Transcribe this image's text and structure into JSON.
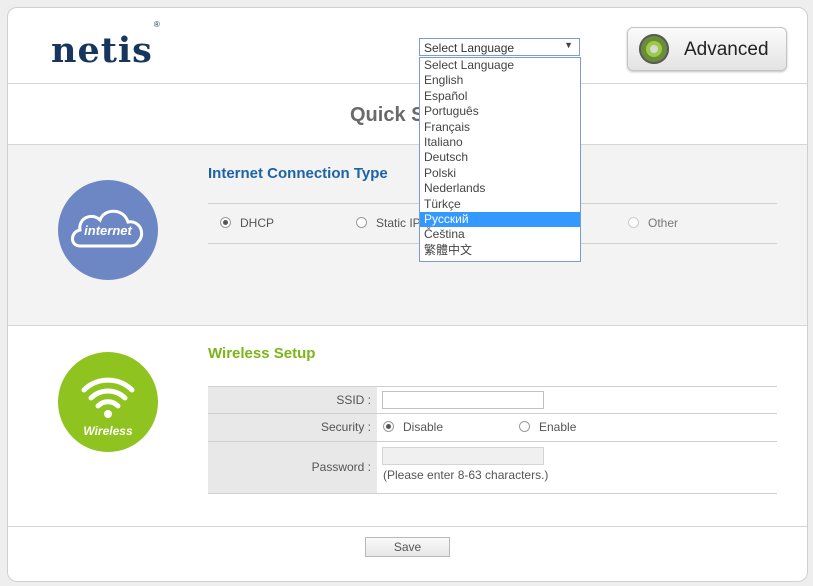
{
  "header": {
    "logo": "netis",
    "logo_mark": "®",
    "language_select": {
      "current": "Select Language",
      "options": [
        "Select Language",
        "English",
        "Español",
        "Português",
        "Français",
        "Italiano",
        "Deutsch",
        "Polski",
        "Nederlands",
        "Türkçe",
        "Русский",
        "Čeština",
        "繁體中文"
      ],
      "highlighted": "Русский"
    },
    "advanced_button": {
      "label": "Advanced",
      "icon": "gear-icon"
    }
  },
  "page": {
    "title": "Quick S"
  },
  "internet_section": {
    "icon_label": "internet",
    "title": "Internet Connection Type",
    "options": [
      {
        "label": "DHCP",
        "checked": true
      },
      {
        "label": "Static IP",
        "checked": false
      },
      {
        "label": "Other",
        "checked": false
      }
    ]
  },
  "wireless_section": {
    "icon_label": "Wireless",
    "title": "Wireless Setup",
    "ssid_label": "SSID :",
    "ssid_value": "",
    "security_label": "Security :",
    "security_options": [
      {
        "label": "Disable",
        "checked": true
      },
      {
        "label": "Enable",
        "checked": false
      }
    ],
    "password_label": "Password :",
    "password_value": "",
    "password_hint": "(Please enter 8-63 characters.)"
  },
  "footer": {
    "save_label": "Save"
  },
  "colors": {
    "brand": "#16365e",
    "internet_title": "#1c63a8",
    "wireless_title": "#7cb518",
    "internet_circle": "#6d87c4",
    "wireless_circle": "#8fc31f",
    "highlight": "#3399ff"
  }
}
